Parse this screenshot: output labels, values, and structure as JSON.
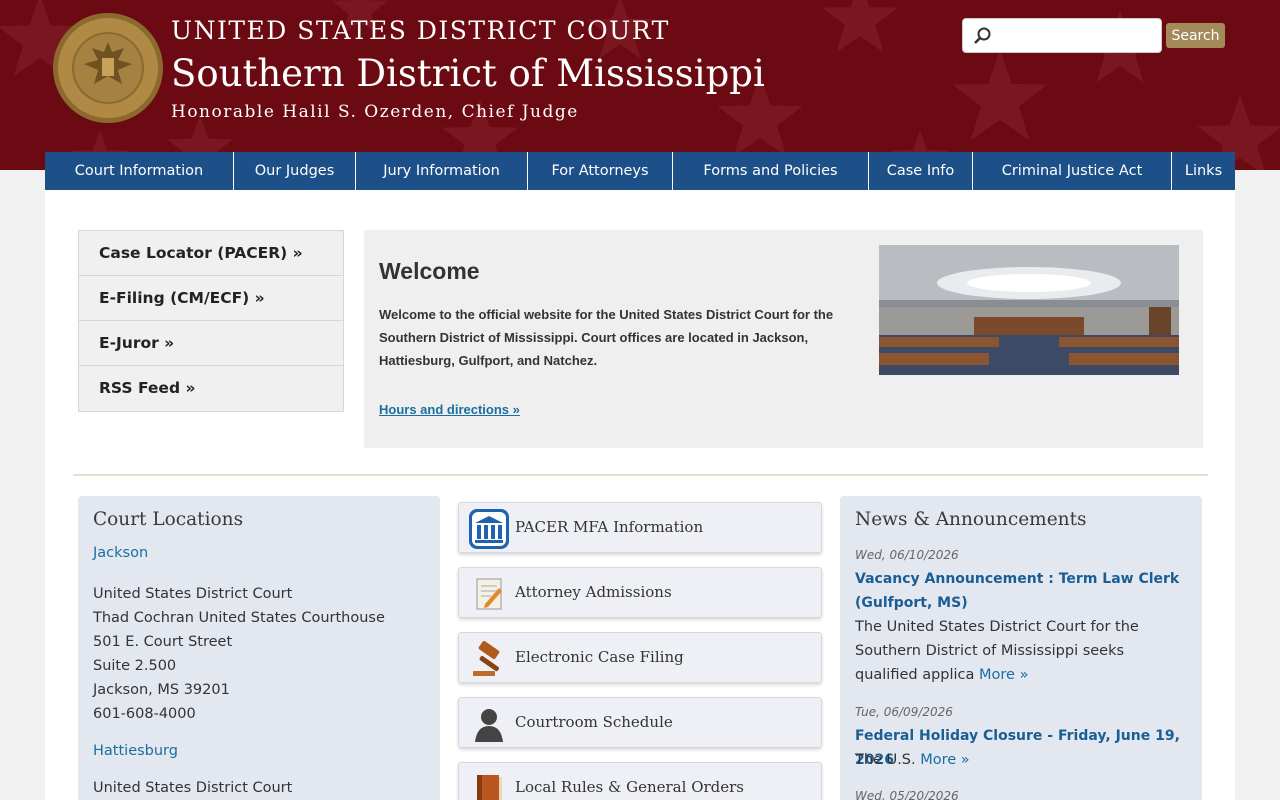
{
  "header": {
    "line1": "UNITED STATES DISTRICT COURT",
    "line2": "Southern District of Mississippi",
    "line3": "Honorable Halil S. Ozerden, Chief Judge",
    "search_placeholder": "",
    "search_button": "Search"
  },
  "nav": [
    "Court Information",
    "Our Judges",
    "Jury Information",
    "For Attorneys",
    "Forms and Policies",
    "Case Info",
    "Criminal Justice Act",
    "Links"
  ],
  "quick_links": [
    "Case Locator (PACER) »",
    "E-Filing (CM/ECF) »",
    "E-Juror »",
    "RSS Feed »"
  ],
  "welcome": {
    "title": "Welcome",
    "text": "Welcome to the official website for the United States District Court for the Southern District of Mississippi. Court offices are located in Jackson, Hattiesburg, Gulfport, and Natchez.",
    "link": "Hours and directions »"
  },
  "locations": {
    "title": "Court Locations",
    "jackson_link": "Jackson",
    "jackson_lines": [
      "United States District Court",
      "Thad Cochran United States Courthouse",
      "501 E. Court Street",
      "Suite 2.500",
      "Jackson, MS 39201",
      "601-608-4000"
    ],
    "hattiesburg_link": "Hattiesburg",
    "hattiesburg_line1": "United States District Court"
  },
  "resource_links": [
    "PACER MFA Information",
    "Attorney Admissions",
    "Electronic Case Filing",
    "Courtroom Schedule",
    "Local Rules & General Orders"
  ],
  "news": {
    "title": "News & Announcements",
    "items": [
      {
        "date": "Wed, 06/10/2026",
        "title": "Vacancy Announcement : Term Law Clerk (Gulfport, MS)",
        "body": "The United States District Court for the Southern District of Mississippi seeks qualified applica",
        "more": "More »"
      },
      {
        "date": "Tue, 06/09/2026",
        "title": "Federal Holiday Closure - Friday, June 19, 2026",
        "body": "The U.S.",
        "more": "More »"
      },
      {
        "date": "Wed, 05/20/2026"
      }
    ]
  },
  "colors": {
    "header_bg": "#6b0a12",
    "nav_bg": "#1d4f88",
    "link": "#1a6fa0",
    "search_button": "#a48a5a"
  }
}
